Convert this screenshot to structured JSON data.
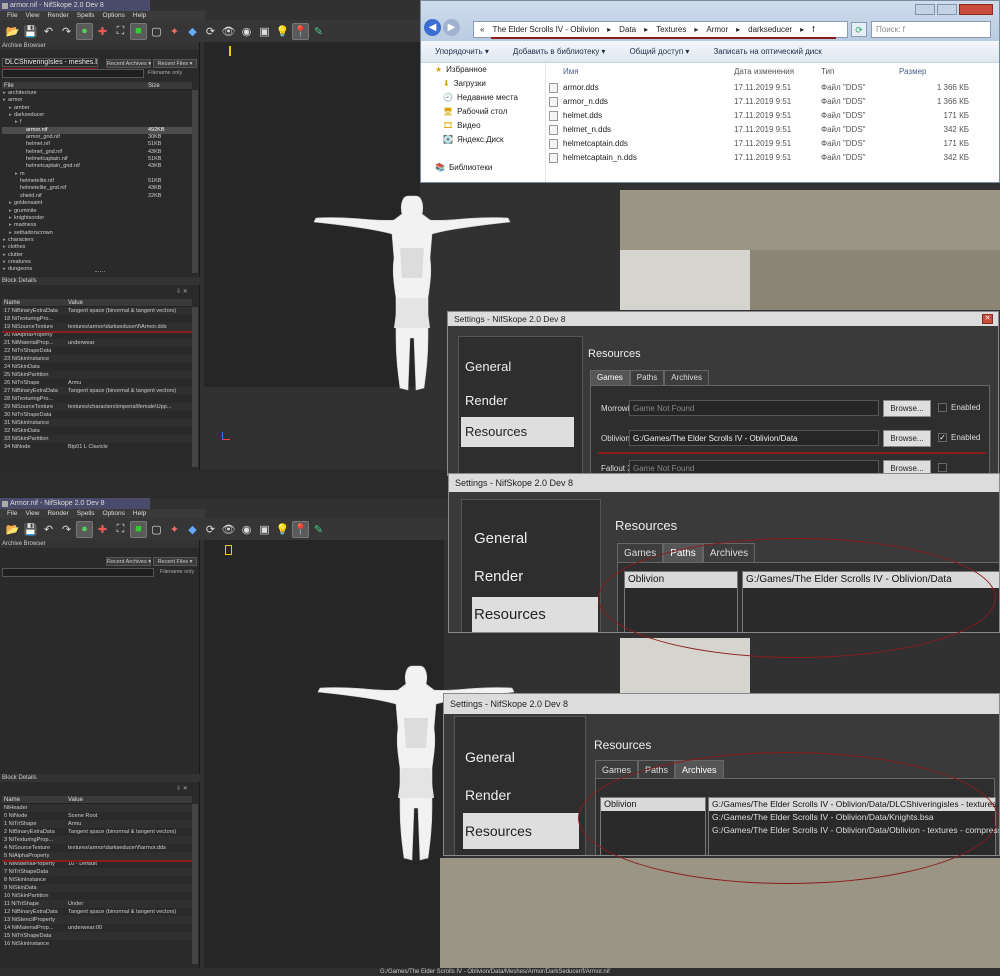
{
  "top": {
    "title": "armor.nif - NifSkope 2.0 Dev 8",
    "menu": [
      "File",
      "View",
      "Render",
      "Spells",
      "Options",
      "Help"
    ],
    "archive_browser": "Archive Browser",
    "archive_name": "DLCShiveringIsles - meshes.bsa",
    "recent_archives": "Recent Archives ▾",
    "recent_files": "Recent Files ▾",
    "filename_only": "Filename only",
    "col_file": "File",
    "col_size": "Size",
    "tree": [
      {
        "name": "architecture",
        "size": "",
        "indent": 1
      },
      {
        "name": "armor",
        "size": "",
        "indent": 1
      },
      {
        "name": "amber",
        "size": "",
        "indent": 2
      },
      {
        "name": "darkseducer",
        "size": "",
        "indent": 2
      },
      {
        "name": "f",
        "size": "",
        "indent": 3
      },
      {
        "name": "armor.nif",
        "size": "492KB",
        "indent": 4,
        "sel": true
      },
      {
        "name": "armor_gnd.nif",
        "size": "30KB",
        "indent": 4
      },
      {
        "name": "helmet.nif",
        "size": "51KB",
        "indent": 4
      },
      {
        "name": "helmet_gnd.nif",
        "size": "43KB",
        "indent": 4
      },
      {
        "name": "helmetcaptain.nif",
        "size": "51KB",
        "indent": 4
      },
      {
        "name": "helmetcaptain_gnd.nif",
        "size": "43KB",
        "indent": 4
      },
      {
        "name": "m",
        "size": "",
        "indent": 3
      },
      {
        "name": "helmetelite.nif",
        "size": "51KB",
        "indent": 3
      },
      {
        "name": "helmetelite_gnd.nif",
        "size": "43KB",
        "indent": 3
      },
      {
        "name": "shield.nif",
        "size": "22KB",
        "indent": 3
      },
      {
        "name": "goldensaint",
        "size": "",
        "indent": 2
      },
      {
        "name": "gruminite",
        "size": "",
        "indent": 2
      },
      {
        "name": "knightsorder",
        "size": "",
        "indent": 2
      },
      {
        "name": "madness",
        "size": "",
        "indent": 2
      },
      {
        "name": "sethadorscrown",
        "size": "",
        "indent": 2
      },
      {
        "name": "characters",
        "size": "",
        "indent": 1
      },
      {
        "name": "clothes",
        "size": "",
        "indent": 1
      },
      {
        "name": "clutter",
        "size": "",
        "indent": 1
      },
      {
        "name": "creatures",
        "size": "",
        "indent": 1
      },
      {
        "name": "dungeons",
        "size": "",
        "indent": 1
      }
    ],
    "block_details": "Block Details",
    "col_name": "Name",
    "col_value": "Value",
    "blocks": [
      {
        "n": "17 NiBinaryExtraData",
        "v": "Tangent space (binormal & tangent vectors)"
      },
      {
        "n": "18 NiTexturingPro...",
        "v": ""
      },
      {
        "n": "19 NiSourceTexture",
        "v": "textures\\armor\\darkseducer\\f\\Armor.dds"
      },
      {
        "n": "20 NiAlphaProperty",
        "v": ""
      },
      {
        "n": "21 NiMaterialProp...",
        "v": "underwear"
      },
      {
        "n": "22 NiTriShapeData",
        "v": ""
      },
      {
        "n": "23 NiSkinInstance",
        "v": ""
      },
      {
        "n": "24 NiSkinData",
        "v": ""
      },
      {
        "n": "25 NiSkinPartition",
        "v": ""
      },
      {
        "n": "26 NiTriShape",
        "v": "Armu"
      },
      {
        "n": "27 NiBinaryExtraData",
        "v": "Tangent space (binormal & tangent vectors)"
      },
      {
        "n": "28 NiTexturingPro...",
        "v": ""
      },
      {
        "n": "29 NiSourceTexture",
        "v": "textures\\characters\\imperial\\female\\Upp..."
      },
      {
        "n": "30 NiTriShapeData",
        "v": ""
      },
      {
        "n": "31 NiSkinInstance",
        "v": ""
      },
      {
        "n": "32 NiSkinData",
        "v": ""
      },
      {
        "n": "33 NiSkinPartition",
        "v": ""
      },
      {
        "n": "34 NiNode",
        "v": "Bip01 L Clavicle"
      }
    ]
  },
  "bottom": {
    "title": "Armor.nif - NifSkope 2.0 Dev 8",
    "menu": [
      "File",
      "View",
      "Render",
      "Spells",
      "Options",
      "Help"
    ],
    "archive_browser": "Archive Browser",
    "recent_archives": "Recent Archives ▾",
    "recent_files": "Recent Files ▾",
    "filename_only": "Filename only",
    "block_details": "Block Details",
    "col_name": "Name",
    "col_value": "Value",
    "blocks": [
      {
        "n": "NiHeader",
        "v": ""
      },
      {
        "n": "0 NiNode",
        "v": "Scene Root"
      },
      {
        "n": "1 NiTriShape",
        "v": "Armu"
      },
      {
        "n": "2 NiBinaryExtraData",
        "v": "Tangent space (binormal & tangent vectors)"
      },
      {
        "n": "3 NiTexturingProp...",
        "v": ""
      },
      {
        "n": "4 NiSourceTexture",
        "v": "textures\\armor\\darkseducer\\f\\armor.dds"
      },
      {
        "n": "5 NiAlphaProperty",
        "v": ""
      },
      {
        "n": "6 NiMaterialProperty",
        "v": "10 - Default"
      },
      {
        "n": "7 NiTriShapeData",
        "v": ""
      },
      {
        "n": "8 NiSkinInstance",
        "v": ""
      },
      {
        "n": "9 NiSkinData",
        "v": ""
      },
      {
        "n": "10 NiSkinPartition",
        "v": ""
      },
      {
        "n": "11 NiTriShape",
        "v": "Under"
      },
      {
        "n": "12 NiBinaryExtraData",
        "v": "Tangent space (binormal & tangent vectors)"
      },
      {
        "n": "13 NiStencilProperty",
        "v": ""
      },
      {
        "n": "14 NiMaterialProp...",
        "v": "underwear:00"
      },
      {
        "n": "15 NiTriShapeData",
        "v": ""
      },
      {
        "n": "16 NiSkinInstance",
        "v": ""
      }
    ],
    "status_path": "G:/Games/The Elder Scrolls IV - Oblivion/Data/Meshes/Armor/DarkSeducer/f/Armor.nif"
  },
  "explorer": {
    "breadcrumb": [
      "«",
      "The Elder Scrolls IV - Oblivion",
      "▸",
      "Data",
      "▸",
      "Textures",
      "▸",
      "Armor",
      "▸",
      "darkseducer",
      "▸",
      "f"
    ],
    "search_placeholder": "Поиск: f",
    "commands": [
      "Упорядочить ▾",
      "Добавить в библиотеку ▾",
      "Общий доступ ▾",
      "Записать на оптический диск"
    ],
    "sidebar": [
      "Избранное",
      "Загрузки",
      "Недавние места",
      "Рабочий стол",
      "Видео",
      "Яндекс.Диск",
      "",
      "Библиотеки"
    ],
    "col_name": "Имя",
    "col_date": "Дата изменения",
    "col_type": "Тип",
    "col_size": "Размер",
    "files": [
      {
        "name": "armor.dds",
        "date": "17.11.2019 9:51",
        "type": "Файл \"DDS\"",
        "size": "1 366 КБ"
      },
      {
        "name": "armor_n.dds",
        "date": "17.11.2019 9:51",
        "type": "Файл \"DDS\"",
        "size": "1 366 КБ"
      },
      {
        "name": "helmet.dds",
        "date": "17.11.2019 9:51",
        "type": "Файл \"DDS\"",
        "size": "171 КБ"
      },
      {
        "name": "helmet_n.dds",
        "date": "17.11.2019 9:51",
        "type": "Файл \"DDS\"",
        "size": "342 КБ"
      },
      {
        "name": "helmetcaptain.dds",
        "date": "17.11.2019 9:51",
        "type": "Файл \"DDS\"",
        "size": "171 КБ"
      },
      {
        "name": "helmetcaptain_n.dds",
        "date": "17.11.2019 9:51",
        "type": "Файл \"DDS\"",
        "size": "342 КБ"
      }
    ]
  },
  "settings_games": {
    "title": "Settings - NifSkope 2.0 Dev 8",
    "nav": [
      "General",
      "Render",
      "Resources"
    ],
    "heading": "Resources",
    "tabs": [
      "Games",
      "Paths",
      "Archives"
    ],
    "rows": [
      {
        "game": "Morrowind",
        "path": "Game Not Found",
        "browse": "Browse...",
        "enabled": "Enabled",
        "checked": false
      },
      {
        "game": "Oblivion",
        "path": "G:/Games/The Elder Scrolls IV - Oblivion/Data",
        "browse": "Browse...",
        "enabled": "Enabled",
        "checked": true
      },
      {
        "game": "Fallout 3",
        "path": "Game Not Found",
        "browse": "Browse...",
        "enabled": "",
        "checked": false
      }
    ]
  },
  "settings_paths": {
    "title": "Settings - NifSkope 2.0 Dev 8",
    "nav": [
      "General",
      "Render",
      "Resources"
    ],
    "heading": "Resources",
    "tabs": [
      "Games",
      "Paths",
      "Archives"
    ],
    "left": "Oblivion",
    "right": "G:/Games/The Elder Scrolls IV - Oblivion/Data"
  },
  "settings_archives": {
    "title": "Settings - NifSkope 2.0 Dev 8",
    "nav": [
      "General",
      "Render",
      "Resources"
    ],
    "heading": "Resources",
    "tabs": [
      "Games",
      "Paths",
      "Archives"
    ],
    "left": "Oblivion",
    "archives": [
      "G:/Games/The Elder Scrolls IV - Oblivion/Data/DLCShiveringisles - textures.bsa",
      "G:/Games/The Elder Scrolls IV - Oblivion/Data/Knights.bsa",
      "G:/Games/The Elder Scrolls IV - Oblivion/Data/Oblivion - textures - compressed.bsa"
    ]
  },
  "colors": {
    "accent_red": "#8b1c1c",
    "selection": "#d9d9d9",
    "dark_bg": "#2b2b2b"
  }
}
